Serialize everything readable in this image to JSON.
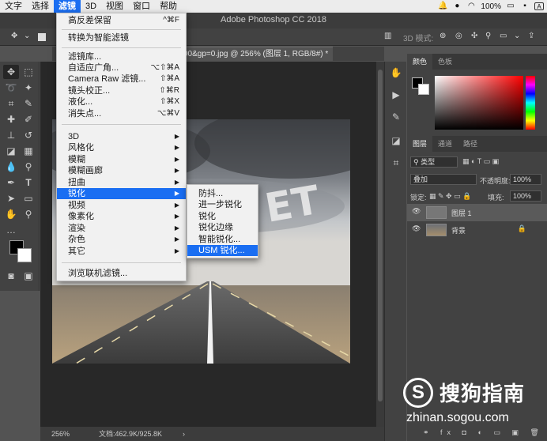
{
  "menubar": {
    "items": [
      "文字",
      "选择",
      "滤镜",
      "3D",
      "视图",
      "窗口",
      "帮助"
    ],
    "battery": "100%",
    "status_icons": [
      "bell-icon",
      "wechat-icon",
      "wifi-icon",
      "battery-icon",
      "flag-icon",
      "input-method-icon"
    ]
  },
  "app": {
    "title": "Adobe Photoshop CC 2018"
  },
  "options_bar": {
    "mode_label": "3D 模式:"
  },
  "document": {
    "tab_title": "00&gp=0.jpg @ 256% (图层 1, RGB/8#) *"
  },
  "status_bar": {
    "zoom": "256%",
    "doc_info": "文档:462.9K/925.8K"
  },
  "filter_menu": {
    "items": [
      {
        "label": "高反差保留",
        "shortcut": "^⌘F"
      },
      {
        "label": "转换为智能滤镜"
      },
      {
        "label": "滤镜库..."
      },
      {
        "label": "自适应广角...",
        "shortcut": "⌥⇧⌘A"
      },
      {
        "label": "Camera Raw 滤镜...",
        "shortcut": "⇧⌘A"
      },
      {
        "label": "镜头校正...",
        "shortcut": "⇧⌘R"
      },
      {
        "label": "液化...",
        "shortcut": "⇧⌘X"
      },
      {
        "label": "消失点...",
        "shortcut": "⌥⌘V"
      },
      {
        "label": "3D"
      },
      {
        "label": "风格化"
      },
      {
        "label": "模糊"
      },
      {
        "label": "模糊画廊"
      },
      {
        "label": "扭曲"
      },
      {
        "label": "锐化"
      },
      {
        "label": "视频"
      },
      {
        "label": "像素化"
      },
      {
        "label": "渲染"
      },
      {
        "label": "杂色"
      },
      {
        "label": "其它"
      },
      {
        "label": "浏览联机滤镜..."
      }
    ]
  },
  "sharpen_submenu": {
    "items": [
      "防抖...",
      "进一步锐化",
      "锐化",
      "锐化边缘",
      "智能锐化...",
      "USM 锐化..."
    ],
    "highlighted": "USM 锐化..."
  },
  "color_panel": {
    "tabs": [
      "颜色",
      "色板"
    ],
    "foreground": "#000000",
    "background": "#ffffff"
  },
  "layers_panel": {
    "tabs": [
      "图层",
      "通道",
      "路径"
    ],
    "kind_filter": "类型",
    "blend_mode": "叠加",
    "opacity_label": "不透明度:",
    "opacity_value": "100%",
    "lock_label": "锁定:",
    "fill_label": "填充:",
    "fill_value": "100%",
    "layers": [
      {
        "name": "图层 1",
        "selected": true
      },
      {
        "name": "背景",
        "locked": true
      }
    ]
  },
  "watermark": {
    "brand": "搜狗指南",
    "url": "zhinan.sogou.com"
  },
  "colors": {
    "accent": "#1a6ef2",
    "panel": "#424242",
    "canvas": "#282828"
  }
}
